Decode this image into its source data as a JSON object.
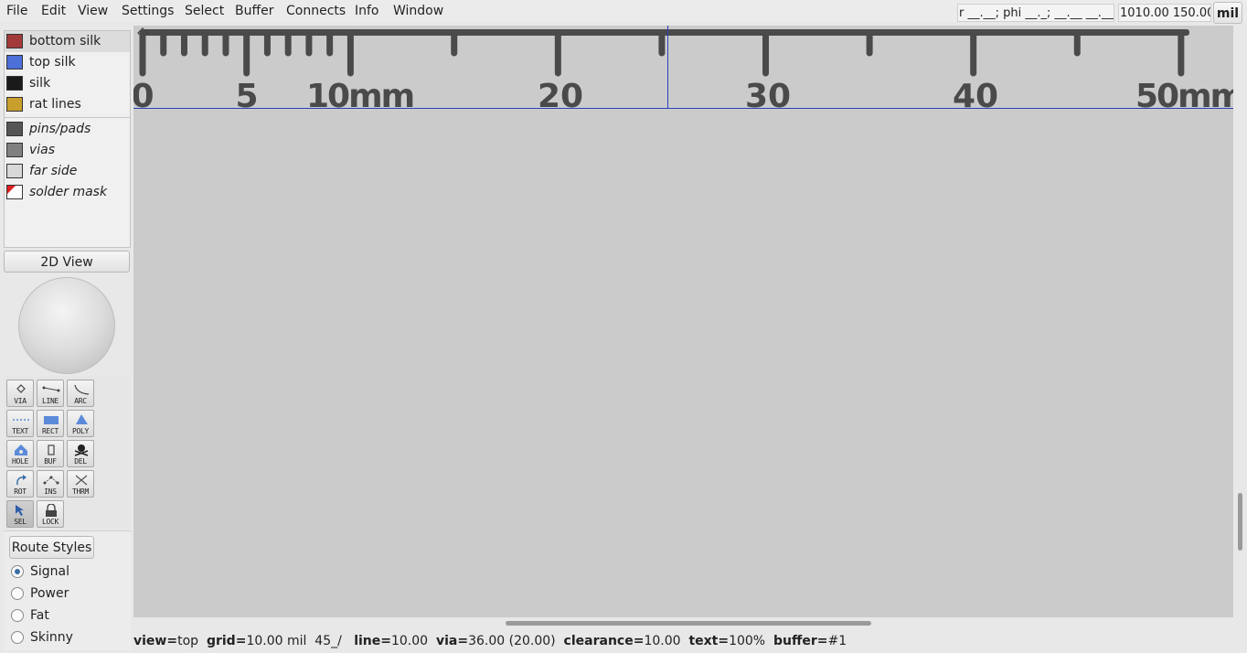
{
  "menu": [
    "File",
    "Edit",
    "View",
    "Settings",
    "Select",
    "Buffer",
    "Connects",
    "Info",
    "Window"
  ],
  "toolbar": {
    "coord_polar": "r __.__; phi __._; __.__ __.__",
    "coord_xy": "1010.00 150.00",
    "unit": "mil"
  },
  "layers": [
    {
      "label": "bottom silk",
      "color": "#a33a3a",
      "italic": false,
      "selected": true
    },
    {
      "label": "top silk",
      "color": "#4c6fd8",
      "italic": false,
      "selected": false
    },
    {
      "label": "silk",
      "color": "#1a1a1a",
      "italic": false,
      "selected": false
    },
    {
      "label": "rat lines",
      "color": "#c9a02e",
      "italic": false,
      "selected": false
    },
    {
      "label": "pins/pads",
      "color": "#555555",
      "italic": true,
      "selected": false
    },
    {
      "label": "vias",
      "color": "#808080",
      "italic": true,
      "selected": false
    },
    {
      "label": "far side",
      "color": "#d8d8d8",
      "italic": true,
      "selected": false
    },
    {
      "label": "solder mask",
      "color": "#ffffff",
      "italic": true,
      "selected": false
    }
  ],
  "view_button": "2D View",
  "tools": [
    {
      "label": "VIA",
      "icon": "via-icon"
    },
    {
      "label": "LINE",
      "icon": "line-icon"
    },
    {
      "label": "ARC",
      "icon": "arc-icon"
    },
    {
      "label": "TEXT",
      "icon": "text-icon"
    },
    {
      "label": "RECT",
      "icon": "rect-icon"
    },
    {
      "label": "POLY",
      "icon": "poly-icon"
    },
    {
      "label": "HOLE",
      "icon": "hole-icon"
    },
    {
      "label": "BUF",
      "icon": "buffer-icon"
    },
    {
      "label": "DEL",
      "icon": "delete-icon"
    },
    {
      "label": "ROT",
      "icon": "rotate-icon"
    },
    {
      "label": "INS",
      "icon": "insert-icon"
    },
    {
      "label": "THRM",
      "icon": "thermal-icon"
    },
    {
      "label": "SEL",
      "icon": "select-arrow-icon"
    },
    {
      "label": "LOCK",
      "icon": "lock-icon"
    }
  ],
  "active_tool": "SEL",
  "route_styles": {
    "button": "Route Styles",
    "options": [
      "Signal",
      "Power",
      "Fat",
      "Skinny"
    ],
    "selected": "Signal"
  },
  "ruler": {
    "labels": [
      "0",
      "5",
      "10mm",
      "20",
      "30",
      "40",
      "50mm"
    ]
  },
  "status": {
    "view_key": "view=",
    "view_val": "top",
    "grid_key": "grid=",
    "grid_val": "10.00 mil",
    "angle": "45_/",
    "line_key": "line=",
    "line_val": "10.00",
    "via_key": "via=",
    "via_val": "36.00 (20.00)",
    "clearance_key": "clearance=",
    "clearance_val": "10.00",
    "text_key": "text=",
    "text_val": "100%",
    "buffer_key": "buffer=",
    "buffer_val": "#1"
  }
}
